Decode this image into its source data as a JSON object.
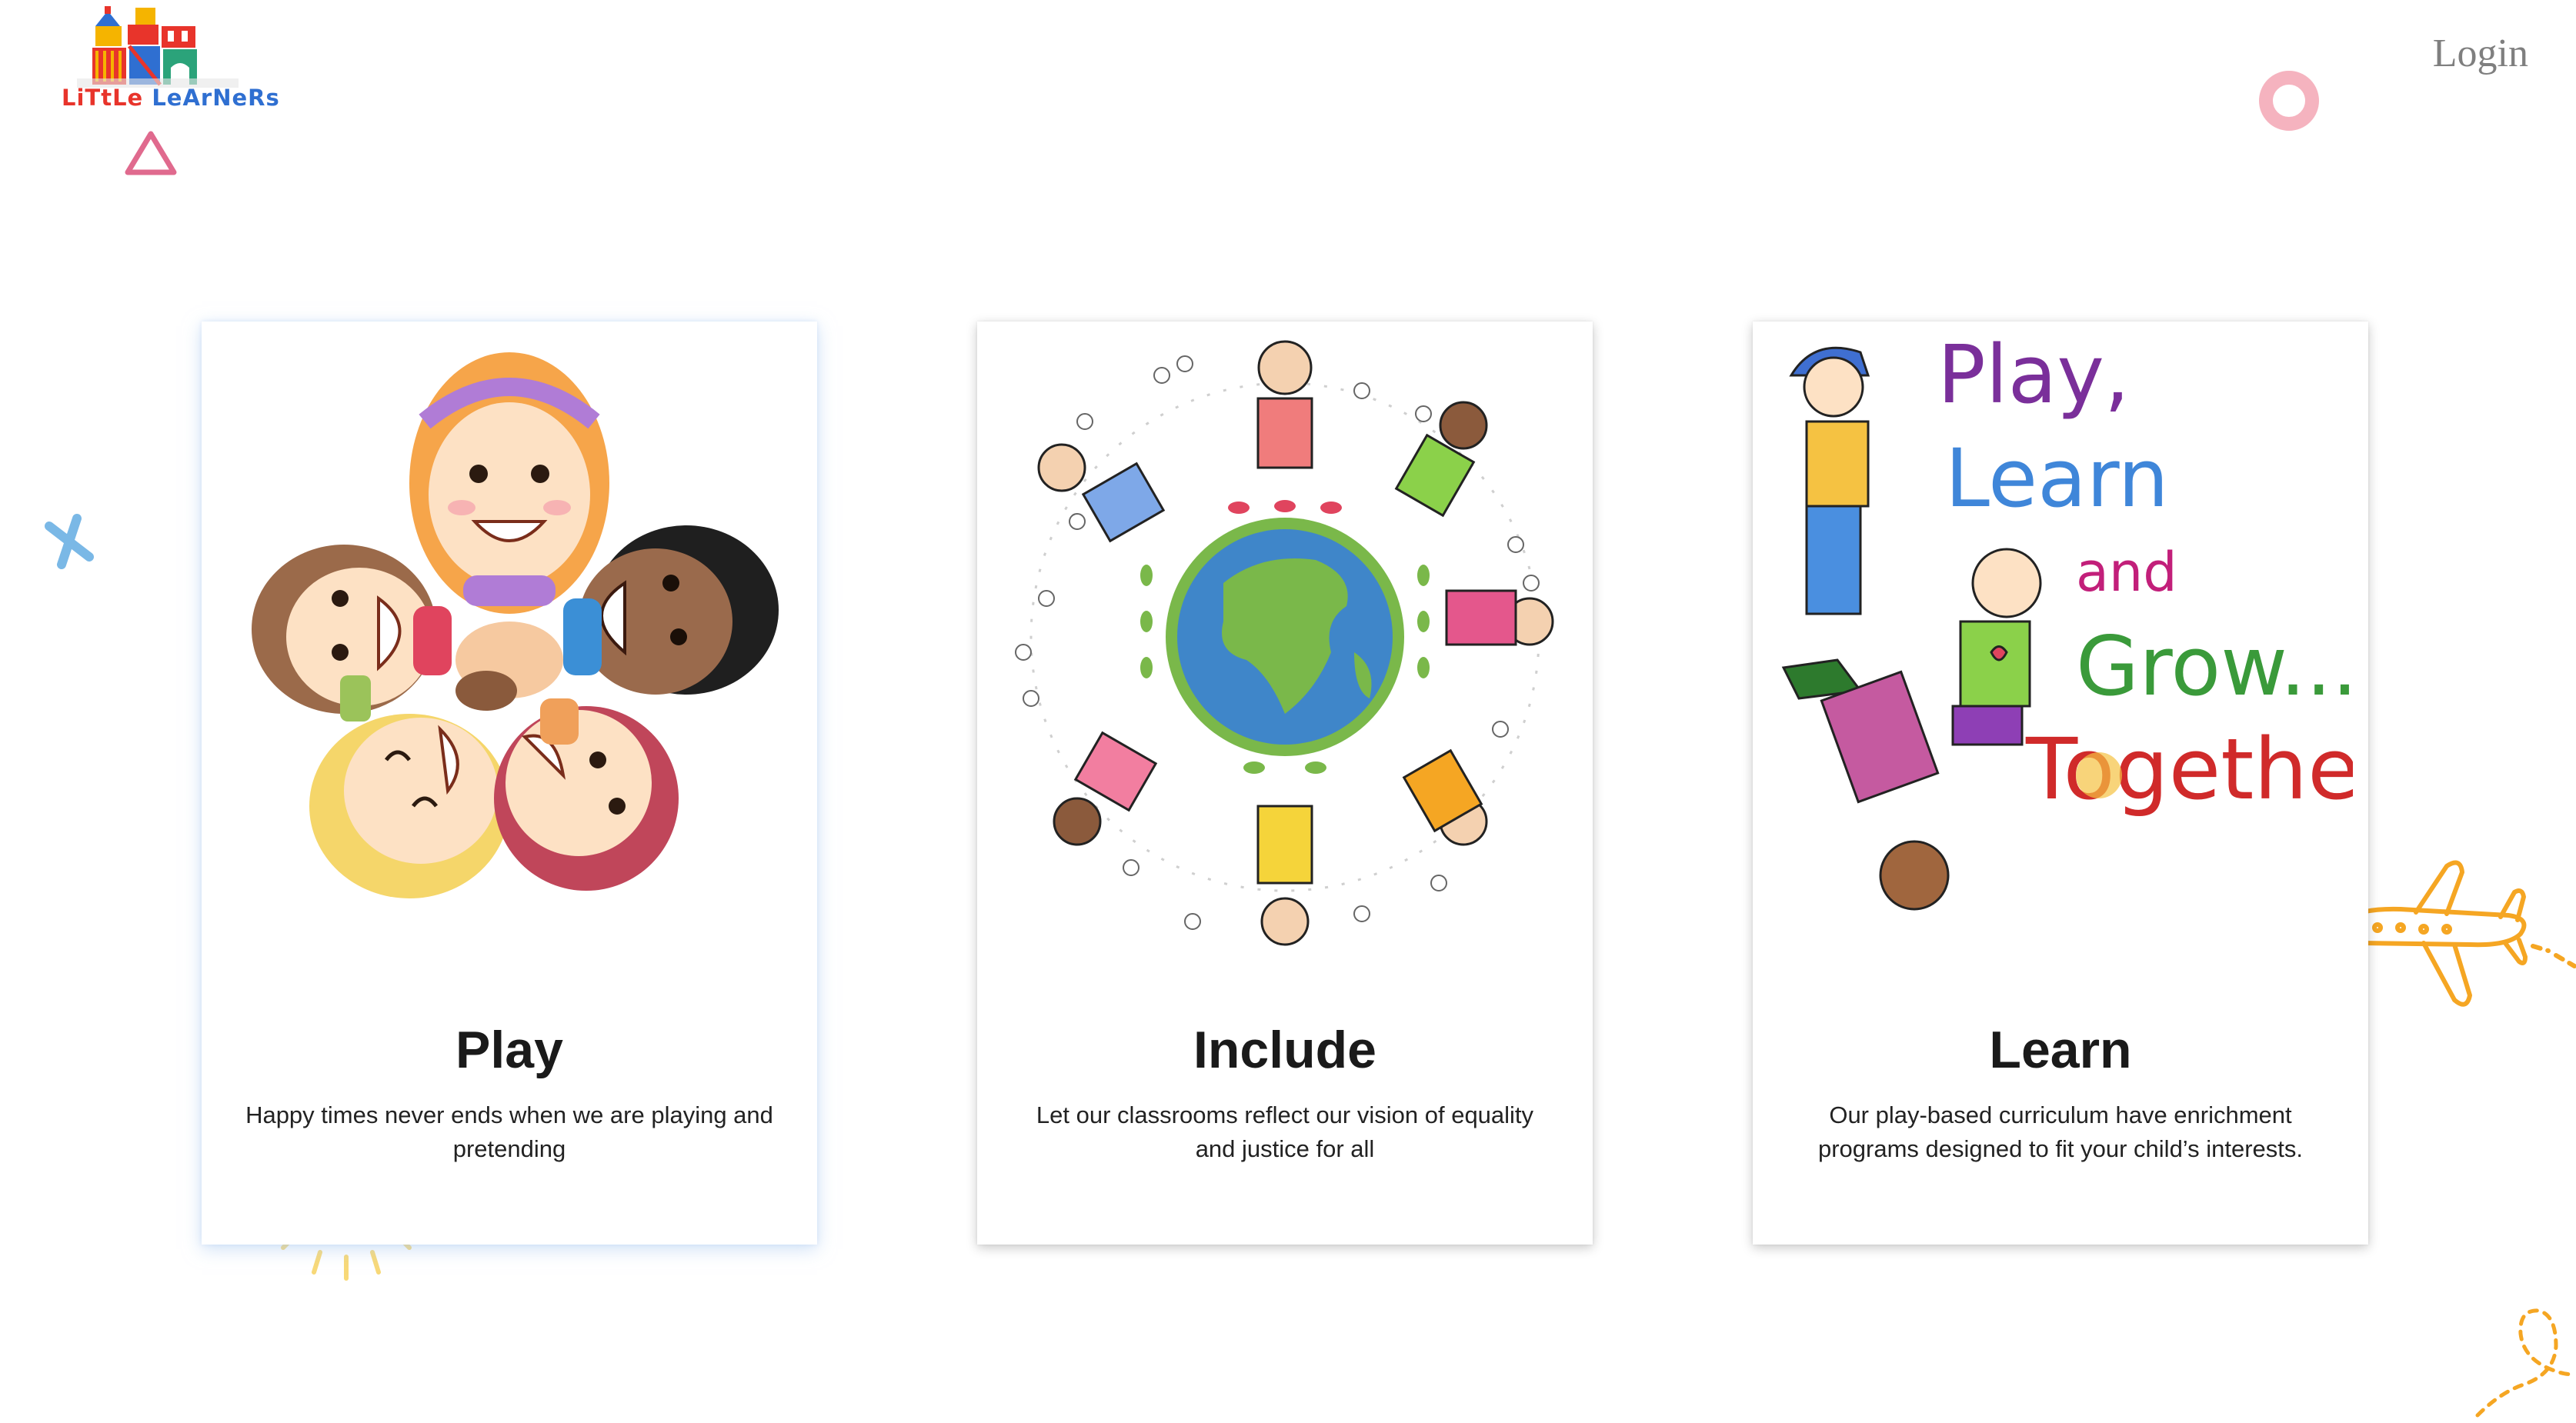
{
  "header": {
    "logo": {
      "word1": "LiTtLe",
      "word2": "LeArNeRs"
    },
    "login_label": "Login"
  },
  "cards": [
    {
      "title": "Play",
      "description": "Happy times never ends when we are playing and pretending"
    },
    {
      "title": "Include",
      "description": "Let our classrooms reflect our vision of equality and justice for all"
    },
    {
      "title": "Learn",
      "description": "Our play-based curriculum have enrichment programs designed to fit your child’s interests."
    }
  ],
  "learn_art": {
    "line1": "Play,",
    "line2": "Learn",
    "line3": "and",
    "line4": "Grow...",
    "line5": "Together!"
  },
  "colors": {
    "logo_red": "#e8342b",
    "logo_blue": "#2f6fd1",
    "triangle_pink": "#e06a8e",
    "cross_blue": "#7ab8e6",
    "circle_pink": "#f3a6b4",
    "sun_yellow": "#f8d978",
    "plane_orange": "#f5a623"
  },
  "icons": [
    "triangle-icon",
    "cross-icon",
    "circle-icon",
    "sun-icon",
    "airplane-icon",
    "loop-trail-icon"
  ]
}
